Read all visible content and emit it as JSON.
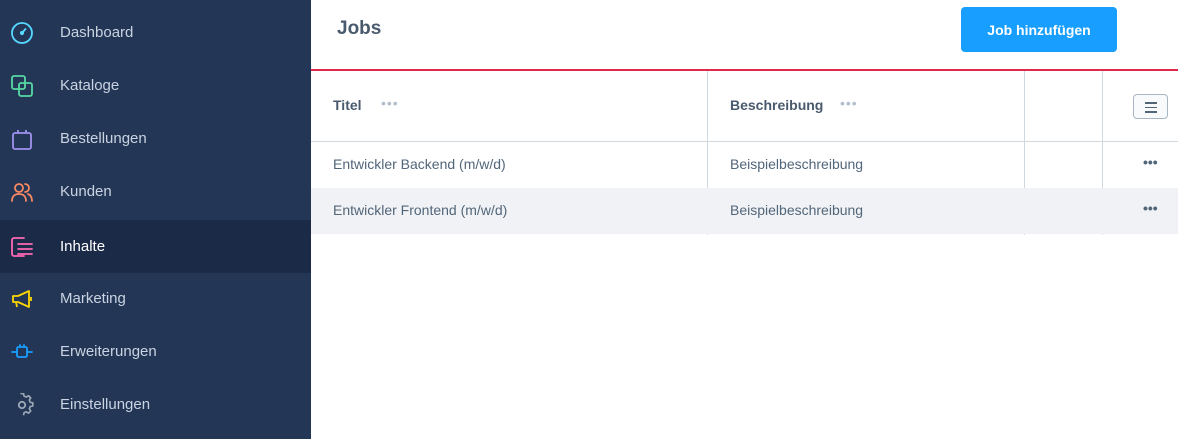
{
  "sidebar": {
    "items": [
      {
        "label": "Dashboard",
        "icon": "gauge-icon",
        "color": "#57d9ff",
        "active": false
      },
      {
        "label": "Kataloge",
        "icon": "copy-icon",
        "color": "#57d9a3",
        "active": false
      },
      {
        "label": "Bestellungen",
        "icon": "shopping-bag-icon",
        "color": "#a092f0",
        "active": false
      },
      {
        "label": "Kunden",
        "icon": "users-icon",
        "color": "#f88962",
        "active": false
      },
      {
        "label": "Inhalte",
        "icon": "content-list-icon",
        "color": "#ff68b4",
        "active": true
      },
      {
        "label": "Marketing",
        "icon": "megaphone-icon",
        "color": "#ffd700",
        "active": false
      },
      {
        "label": "Erweiterungen",
        "icon": "plug-icon",
        "color": "#189eff",
        "active": false
      },
      {
        "label": "Einstellungen",
        "icon": "gear-icon",
        "color": "#9aa8b5",
        "active": false
      }
    ]
  },
  "header": {
    "title": "Jobs",
    "add_button_label": "Job hinzufügen",
    "accent_color": "#de294c",
    "button_color": "#189eff"
  },
  "table": {
    "columns": [
      {
        "label": "Titel",
        "menu": "•••"
      },
      {
        "label": "Beschreibung",
        "menu": "•••"
      }
    ],
    "rows": [
      {
        "title": "Entwickler Backend (m/w/d)",
        "description": "Beispielbeschreibung",
        "actions": "•••"
      },
      {
        "title": "Entwickler Frontend (m/w/d)",
        "description": "Beispielbeschreibung",
        "actions": "•••"
      }
    ]
  }
}
